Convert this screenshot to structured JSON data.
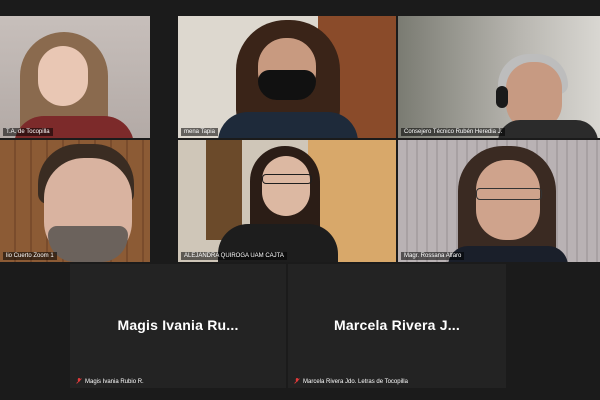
{
  "participants": [
    {
      "label": "T.A. de Tocopilla",
      "muted": false
    },
    {
      "label": "mena Tapia",
      "muted": false
    },
    {
      "label": "Consejero Técnico Rubén Heredia J.",
      "muted": false
    },
    {
      "label": "lio Cuerto Zoom 1",
      "muted": false
    },
    {
      "label": "ALEJANDRA QUIROGA UAM CAJTA",
      "muted": false
    },
    {
      "label": "Magr. Rossana Alfaro",
      "muted": false
    },
    {
      "label": "Magis Ivania Rubio R.",
      "display_name": "Magis Ivania Ru...",
      "muted": true
    },
    {
      "label": "Marcela Rivera Jdo. Letras de Tocopilla",
      "display_name": "Marcela Rivera J...",
      "muted": true
    }
  ],
  "colors": {
    "active_speaker_border": "#c9d23a",
    "muted_icon": "#e03a3a"
  }
}
